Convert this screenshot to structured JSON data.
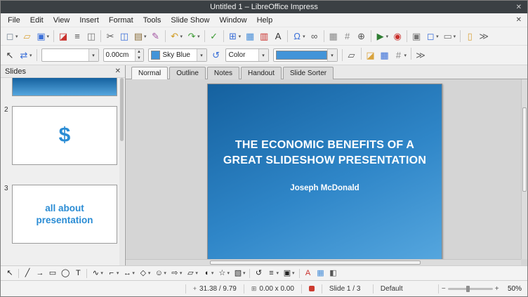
{
  "window": {
    "title": "Untitled 1 – LibreOffice Impress",
    "close_glyph": "✕"
  },
  "menubar": {
    "items": [
      "File",
      "Edit",
      "View",
      "Insert",
      "Format",
      "Tools",
      "Slide Show",
      "Window",
      "Help"
    ],
    "close_glyph": "✕"
  },
  "toolbar_main": {
    "buttons": [
      {
        "name": "new",
        "glyph": "◻",
        "color": "#7a8a99",
        "dropdown": true
      },
      {
        "name": "open",
        "glyph": "▱",
        "color": "#d9a33c"
      },
      {
        "name": "save",
        "glyph": "▣",
        "color": "#3a6fd8",
        "dropdown": true
      },
      {
        "sep": true
      },
      {
        "name": "export-pdf",
        "glyph": "◪",
        "color": "#c9302c"
      },
      {
        "name": "print",
        "glyph": "≡",
        "color": "#555555"
      },
      {
        "name": "print-preview",
        "glyph": "◫",
        "color": "#777777"
      },
      {
        "sep": true
      },
      {
        "name": "cut",
        "glyph": "✂",
        "color": "#555555"
      },
      {
        "name": "copy",
        "glyph": "◫",
        "color": "#3a6fd8"
      },
      {
        "name": "paste",
        "glyph": "▤",
        "color": "#8a6d3b",
        "dropdown": true
      },
      {
        "name": "clone-formatting",
        "glyph": "✎",
        "color": "#a04fa0"
      },
      {
        "sep": true
      },
      {
        "name": "undo",
        "glyph": "↶",
        "color": "#d09a1f",
        "dropdown": true
      },
      {
        "name": "redo",
        "glyph": "↷",
        "color": "#3d9b35",
        "dropdown": true
      },
      {
        "sep": true
      },
      {
        "name": "spelling",
        "glyph": "✓",
        "color": "#3d9b35"
      },
      {
        "sep": true
      },
      {
        "name": "table",
        "glyph": "⊞",
        "color": "#3a6fd8",
        "dropdown": true
      },
      {
        "name": "insert-image",
        "glyph": "▦",
        "color": "#4a90d9"
      },
      {
        "name": "insert-chart",
        "glyph": "▥",
        "color": "#c9302c"
      },
      {
        "name": "insert-textbox",
        "glyph": "A",
        "color": "#333333"
      },
      {
        "sep": true
      },
      {
        "name": "special-character",
        "glyph": "Ω",
        "color": "#3a6fd8",
        "dropdown": true
      },
      {
        "name": "hyperlink",
        "glyph": "∞",
        "color": "#555555"
      },
      {
        "sep": true
      },
      {
        "name": "show-grid",
        "glyph": "▦",
        "color": "#8a8a8a"
      },
      {
        "name": "helplines",
        "glyph": "#",
        "color": "#8a8a8a"
      },
      {
        "name": "zoom",
        "glyph": "⊕",
        "color": "#555555"
      },
      {
        "sep": true
      },
      {
        "name": "start-slideshow",
        "glyph": "▶",
        "color": "#2e7d32",
        "dropdown": true
      },
      {
        "name": "help",
        "glyph": "◉",
        "color": "#c9302c"
      },
      {
        "sep": true
      },
      {
        "name": "master-slide",
        "glyph": "▣",
        "color": "#777777"
      },
      {
        "name": "new-slide",
        "glyph": "◻",
        "color": "#3a6fd8",
        "dropdown": true
      },
      {
        "name": "slide-layout",
        "glyph": "▭",
        "color": "#777777",
        "dropdown": true
      },
      {
        "sep": true
      },
      {
        "name": "slide-properties",
        "glyph": "▯",
        "color": "#d9a33c"
      },
      {
        "name": "toolbar-overflow",
        "glyph": "≫",
        "color": "#666666"
      }
    ]
  },
  "toolbar_line": {
    "buttons_a": [
      {
        "name": "select",
        "glyph": "↖",
        "color": "#333333"
      },
      {
        "name": "transformations",
        "glyph": "⇄",
        "color": "#3a6fd8",
        "dropdown": true
      }
    ],
    "line_style_value": "",
    "line_width_value": "0.00cm",
    "line_color_value": "Sky Blue",
    "line_color_swatch": "#4394d8",
    "fill_style_value": "Color",
    "fill_color_swatch": "#4394d8",
    "buttons_b": [
      {
        "name": "shadow",
        "glyph": "▱",
        "color": "#555555"
      },
      {
        "sep": true
      },
      {
        "name": "gallery",
        "glyph": "◪",
        "color": "#d9a33c"
      },
      {
        "name": "display-grid",
        "glyph": "▦",
        "color": "#3a6fd8"
      },
      {
        "name": "helplines-while-moving",
        "glyph": "#",
        "color": "#8a8a8a",
        "dropdown": true
      },
      {
        "sep": true
      },
      {
        "name": "toolbar-overflow",
        "glyph": "≫",
        "color": "#666666"
      }
    ]
  },
  "view_tabs": {
    "items": [
      "Normal",
      "Outline",
      "Notes",
      "Handout",
      "Slide Sorter"
    ],
    "active": "Normal"
  },
  "slides_panel": {
    "title": "Slides",
    "close_glyph": "✕",
    "slides": [
      {
        "content": ""
      },
      {
        "number": "2",
        "content": "$"
      },
      {
        "number": "3",
        "content": "all about presentation"
      }
    ]
  },
  "slide": {
    "title_lines": [
      "THE ECONOMIC BENEFITS OF A",
      "GREAT SLIDESHOW PRESENTATION"
    ],
    "subtitle": "Joseph McDonald",
    "gradient_top": "#15619f",
    "gradient_bottom": "#55a6de"
  },
  "toolbar_draw": {
    "buttons": [
      {
        "name": "select",
        "glyph": "↖",
        "color": "#222222"
      },
      {
        "sep": true
      },
      {
        "name": "insert-line",
        "glyph": "╱",
        "color": "#222222"
      },
      {
        "name": "line-ends-arrow",
        "glyph": "→",
        "color": "#222222"
      },
      {
        "name": "rectangle",
        "glyph": "▭",
        "color": "#222222"
      },
      {
        "name": "ellipse",
        "glyph": "◯",
        "color": "#222222"
      },
      {
        "name": "text-box",
        "glyph": "T",
        "color": "#222222"
      },
      {
        "sep": true
      },
      {
        "name": "curves-polygons",
        "glyph": "∿",
        "color": "#222222",
        "dropdown": true
      },
      {
        "name": "connectors",
        "glyph": "⌐",
        "color": "#222222",
        "dropdown": true
      },
      {
        "name": "lines-arrows",
        "glyph": "↔",
        "color": "#222222",
        "dropdown": true
      },
      {
        "name": "basic-shapes",
        "glyph": "◇",
        "color": "#222222",
        "dropdown": true
      },
      {
        "name": "symbol-shapes",
        "glyph": "☺",
        "color": "#222222",
        "dropdown": true
      },
      {
        "name": "block-arrows",
        "glyph": "⇨",
        "color": "#222222",
        "dropdown": true
      },
      {
        "name": "flowchart",
        "glyph": "▱",
        "color": "#222222",
        "dropdown": true
      },
      {
        "name": "callout-shapes",
        "glyph": "◖",
        "color": "#222222",
        "dropdown": true
      },
      {
        "name": "stars-banners",
        "glyph": "☆",
        "color": "#222222",
        "dropdown": true
      },
      {
        "name": "3d-objects",
        "glyph": "▧",
        "color": "#222222",
        "dropdown": true
      },
      {
        "sep": true
      },
      {
        "name": "rotate",
        "glyph": "↺",
        "color": "#222222"
      },
      {
        "name": "align-objects",
        "glyph": "≡",
        "color": "#222222",
        "dropdown": true
      },
      {
        "name": "arrange",
        "glyph": "▣",
        "color": "#222222",
        "dropdown": true
      },
      {
        "sep": true
      },
      {
        "name": "fontwork",
        "glyph": "A",
        "color": "#c9302c"
      },
      {
        "name": "insert-image",
        "glyph": "▦",
        "color": "#4a90d9"
      },
      {
        "name": "extrusion-toggle",
        "glyph": "◧",
        "color": "#555555"
      }
    ]
  },
  "statusbar": {
    "position": "31.38 / 9.79",
    "object_size": "0.00 x 0.00",
    "slide_label": "Slide 1 / 3",
    "style_name": "Default",
    "zoom": "50%"
  }
}
